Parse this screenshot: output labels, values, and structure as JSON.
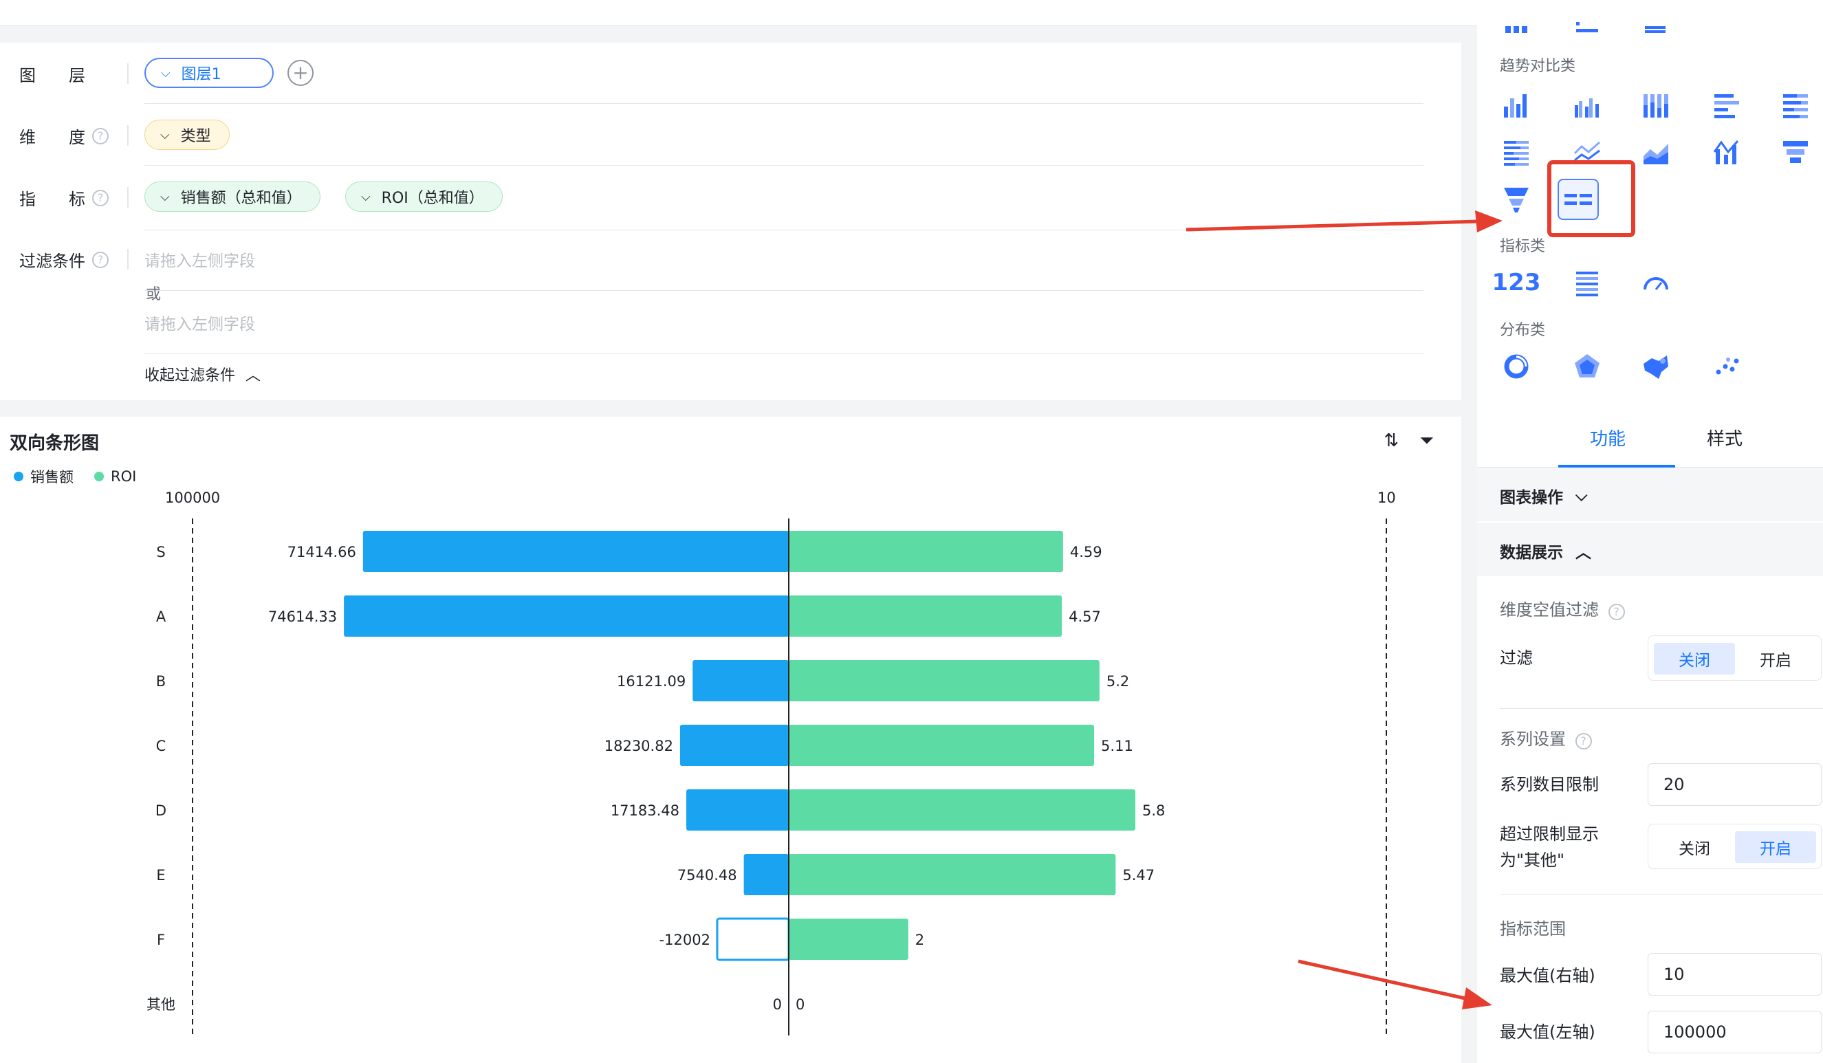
{
  "config": {
    "layer_label": "图　　层",
    "layer_value": "图层1",
    "dimension_label": "维　　度",
    "dimension_value": "类型",
    "metric_label": "指　　标",
    "metric_values": [
      "销售额（总和值）",
      "ROI（总和值）"
    ],
    "filter_label": "过滤条件",
    "filter_placeholder_1": "请拖入左侧字段",
    "filter_or": "或",
    "filter_placeholder_2": "请拖入左侧字段",
    "collapse_filter": "收起过滤条件"
  },
  "chart_card": {
    "title": "双向条形图"
  },
  "chart_data": {
    "type": "bar",
    "orientation": "horizontal-bidirectional",
    "categories": [
      "S",
      "A",
      "B",
      "C",
      "D",
      "E",
      "F",
      "其他"
    ],
    "series": [
      {
        "name": "销售额",
        "axis": "left",
        "color": "#1aa3f0",
        "values": [
          71414.66,
          74614.33,
          16121.09,
          18230.82,
          17183.48,
          7540.48,
          -12002,
          0
        ]
      },
      {
        "name": "ROI",
        "axis": "right",
        "color": "#5ddba4",
        "values": [
          4.59,
          4.57,
          5.2,
          5.11,
          5.8,
          5.47,
          2,
          0
        ]
      }
    ],
    "left_axis_max": 100000,
    "right_axis_max": 10,
    "left_axis_label": "100000",
    "right_axis_label": "10",
    "value_labels_left": [
      "71414.66",
      "74614.33",
      "16121.09",
      "18230.82",
      "17183.48",
      "7540.48",
      "-12002",
      "0"
    ],
    "value_labels_right": [
      "4.59",
      "4.57",
      "5.2",
      "5.11",
      "5.8",
      "5.47",
      "2",
      "0"
    ],
    "legend_placement": "top-left"
  },
  "side": {
    "trend_section": "趋势对比类",
    "metric_section": "指标类",
    "distribution_section": "分布类",
    "tab_function": "功能",
    "tab_style": "样式",
    "chart_ops": "图表操作",
    "data_display": "数据展示",
    "dim_null_filter": "维度空值过滤",
    "filter_label": "过滤",
    "off": "关闭",
    "on": "开启",
    "series_settings": "系列设置",
    "series_limit_label": "系列数目限制",
    "series_limit_value": "20",
    "over_limit_line1": "超过限制显示",
    "over_limit_line2": "为\"其他\"",
    "metric_range": "指标范围",
    "max_right_label": "最大值(右轴)",
    "max_right_value": "10",
    "max_left_label": "最大值(左轴)",
    "max_left_value": "100000"
  },
  "colors": {
    "accent": "#1677ff",
    "series_blue": "#1aa3f0",
    "series_green": "#5ddba4",
    "annotation_red": "#e53e2e"
  }
}
